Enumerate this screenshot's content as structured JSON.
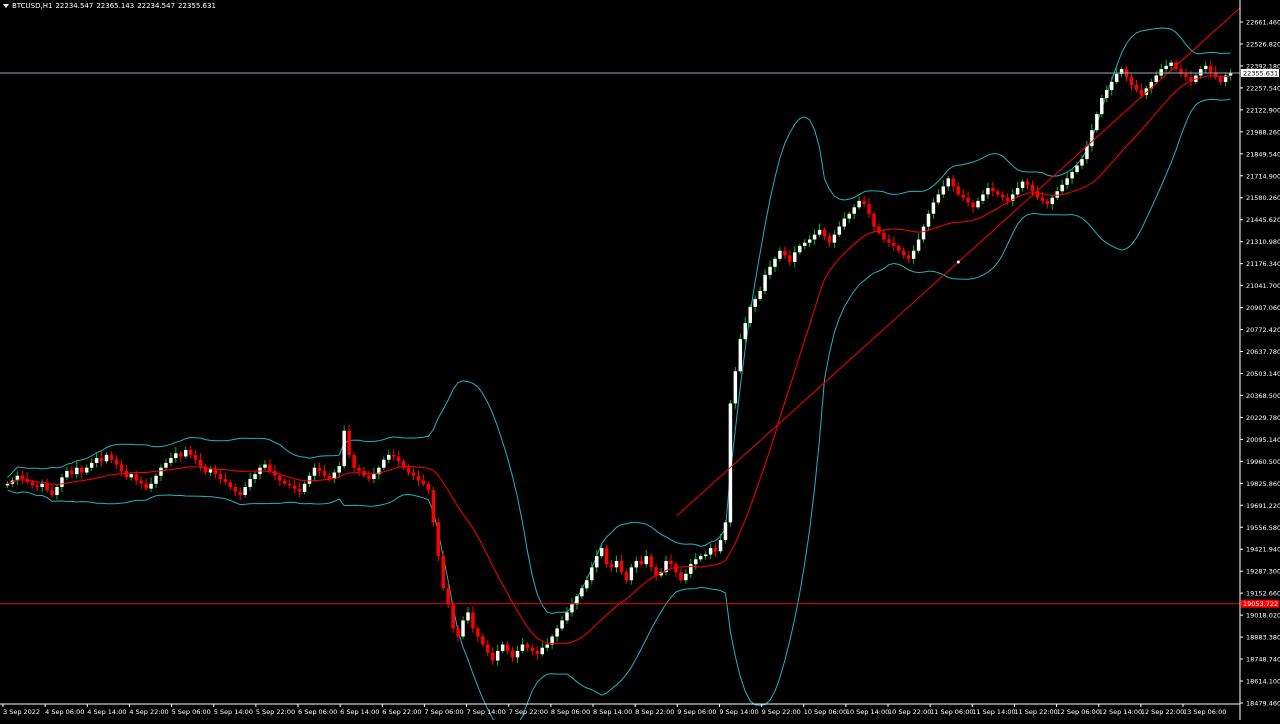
{
  "header": {
    "symbol": "BTCUSD,H1",
    "ohlc": [
      "22234.547",
      "22365.143",
      "22234.547",
      "22355.631"
    ]
  },
  "price_axis": {
    "labels": [
      "22661.460",
      "22526.820",
      "22392.180",
      "22257.540",
      "22122.900",
      "21988.260",
      "21849.540",
      "21714.900",
      "21580.260",
      "21445.620",
      "21310.980",
      "21176.340",
      "21041.700",
      "20907.060",
      "20772.420",
      "20637.780",
      "20503.140",
      "20368.500",
      "20229.780",
      "20095.140",
      "19960.500",
      "19825.860",
      "19691.220",
      "19556.580",
      "19421.940",
      "19287.300",
      "19152.660",
      "19018.020",
      "18883.380",
      "18748.740",
      "18614.100",
      "18479.460"
    ],
    "current_price_label": "22355.631",
    "level_line_label": "19053.722"
  },
  "time_axis": {
    "labels": [
      "3 Sep 2022",
      "4 Sep 06:00",
      "4 Sep 14:00",
      "4 Sep 22:00",
      "5 Sep 06:00",
      "5 Sep 14:00",
      "5 Sep 22:00",
      "6 Sep 06:00",
      "6 Sep 14:00",
      "6 Sep 22:00",
      "7 Sep 06:00",
      "7 Sep 14:00",
      "7 Sep 22:00",
      "8 Sep 06:00",
      "8 Sep 14:00",
      "8 Sep 22:00",
      "9 Sep 06:00",
      "9 Sep 14:00",
      "9 Sep 22:00",
      "10 Sep 06:00",
      "10 Sep 14:00",
      "10 Sep 22:00",
      "11 Sep 06:00",
      "11 Sep 14:00",
      "11 Sep 22:00",
      "12 Sep 06:00",
      "12 Sep 14:00",
      "12 Sep 22:00",
      "13 Sep 06:00"
    ]
  },
  "colors": {
    "background": "#000000",
    "bull_candle": "#ffffff",
    "bull_wick": "#00c000",
    "bear_candle": "#ff0000",
    "bollinger": "#20b2c0",
    "moving_average": "#ff0000",
    "trendline": "#ff0000",
    "level_line": "#ff0000",
    "bid_line": "#8fa8c0",
    "axis_text": "#ffffff"
  },
  "chart_data": {
    "type": "candlestick",
    "symbol": "BTCUSD",
    "timeframe": "H1",
    "y_range": [
      18430,
      22760
    ],
    "current_price": 22355.631,
    "horizontal_level": 19053.722,
    "trendline": {
      "from": {
        "x": "9 Sep 00:00",
        "y": 19600
      },
      "to": {
        "x": "13 Sep 12:00",
        "y": 22760
      }
    },
    "series": [
      {
        "name": "close",
        "x_start": "3 Sep 2022 00:00",
        "x_step_hours": 1,
        "values": [
          19800,
          19820,
          19850,
          19830,
          19810,
          19790,
          19780,
          19800,
          19760,
          19730,
          19780,
          19840,
          19880,
          19860,
          19900,
          19870,
          19900,
          19930,
          19960,
          19940,
          19980,
          19950,
          19920,
          19880,
          19840,
          19860,
          19820,
          19800,
          19770,
          19800,
          19850,
          19900,
          19930,
          19960,
          19990,
          19970,
          20010,
          19980,
          19950,
          19910,
          19870,
          19890,
          19860,
          19830,
          19810,
          19780,
          19750,
          19730,
          19780,
          19830,
          19860,
          19900,
          19920,
          19880,
          19850,
          19820,
          19800,
          19790,
          19770,
          19750,
          19800,
          19850,
          19900,
          19880,
          19850,
          19830,
          19870,
          19910,
          20130,
          19980,
          19900,
          19880,
          19850,
          19830,
          19860,
          19900,
          19950,
          19980,
          19970,
          19940,
          19900,
          19870,
          19850,
          19820,
          19800,
          19760,
          19560,
          19350,
          19150,
          19050,
          18900,
          18850,
          18950,
          19000,
          18900,
          18850,
          18800,
          18750,
          18700,
          18760,
          18800,
          18760,
          18720,
          18760,
          18800,
          18780,
          18760,
          18740,
          18780,
          18800,
          18850,
          18900,
          18950,
          19000,
          19050,
          19100,
          19150,
          19200,
          19280,
          19350,
          19400,
          19300,
          19280,
          19320,
          19250,
          19200,
          19280,
          19320,
          19300,
          19350,
          19280,
          19230,
          19250,
          19320,
          19300,
          19250,
          19200,
          19240,
          19300,
          19330,
          19350,
          19360,
          19400,
          19380,
          19450,
          19560,
          20300,
          20500,
          20700,
          20800,
          20900,
          20950,
          21000,
          21100,
          21150,
          21200,
          21250,
          21220,
          21180,
          21240,
          21280,
          21300,
          21320,
          21350,
          21380,
          21340,
          21300,
          21350,
          21400,
          21450,
          21480,
          21520,
          21560,
          21540,
          21480,
          21400,
          21360,
          21320,
          21300,
          21280,
          21250,
          21220,
          21200,
          21250,
          21320,
          21400,
          21480,
          21550,
          21600,
          21650,
          21700,
          21650,
          21600,
          21580,
          21550,
          21520,
          21560,
          21600,
          21640,
          21620,
          21600,
          21580,
          21560,
          21600,
          21640,
          21680,
          21660,
          21620,
          21580,
          21560,
          21540,
          21580,
          21620,
          21660,
          21700,
          21740,
          21780,
          21820,
          21900,
          22000,
          22100,
          22200,
          22250,
          22300,
          22350,
          22380,
          22330,
          22280,
          22250,
          22220,
          22260,
          22300,
          22340,
          22380,
          22400,
          22420,
          22380,
          22350,
          22330,
          22300,
          22340,
          22380,
          22400,
          22360,
          22330,
          22300,
          22340,
          22355
        ]
      },
      {
        "name": "moving_average",
        "values": []
      },
      {
        "name": "bollinger_upper",
        "values": []
      },
      {
        "name": "bollinger_lower",
        "values": []
      }
    ]
  }
}
